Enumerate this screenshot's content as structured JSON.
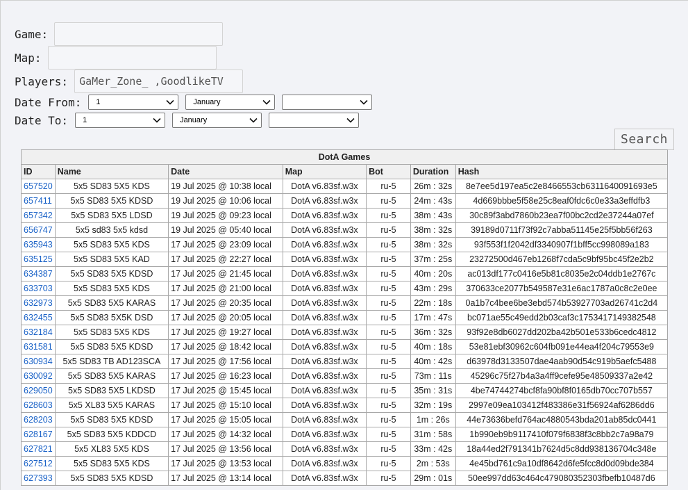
{
  "form": {
    "game_label": "Game:",
    "game_value": "",
    "map_label": "Map:",
    "map_value": "",
    "players_label": "Players:",
    "players_value": "GaMer_Zone_ ,GoodlikeTV",
    "date_from_label": "Date From:",
    "date_from_day": "1",
    "date_from_month": "January",
    "date_from_year": "",
    "date_to_label": "Date To:",
    "date_to_day": "1",
    "date_to_month": "January",
    "date_to_year": "",
    "search_label": "Search"
  },
  "table": {
    "title": "DotA Games",
    "headers": [
      "ID",
      "Name",
      "Date",
      "Map",
      "Bot",
      "Duration",
      "Hash"
    ],
    "rows": [
      [
        "657520",
        "5x5 SD83 5X5 KDS",
        "19 Jul 2025 @ 10:38 local",
        "DotA v6.83sf.w3x",
        "ru-5",
        "26m : 32s",
        "8e7ee5d197ea5c2e8466553cb6311640091693e5"
      ],
      [
        "657411",
        "5x5 SD83 5X5 KDSD",
        "19 Jul 2025 @ 10:06 local",
        "DotA v6.83sf.w3x",
        "ru-5",
        "24m : 43s",
        "4d669bbbe5f58e25c8eaf0fdc6c0e33a3effdfb3"
      ],
      [
        "657342",
        "5x5 SD83 5X5 LDSD",
        "19 Jul 2025 @ 09:23 local",
        "DotA v6.83sf.w3x",
        "ru-5",
        "38m : 43s",
        "30c89f3abd7860b23ea7f00bc2cd2e37244a07ef"
      ],
      [
        "656747",
        "5x5 sd83 5x5 kdsd",
        "19 Jul 2025 @ 05:40 local",
        "DotA v6.83sf.w3x",
        "ru-5",
        "38m : 32s",
        "39189d0711f73f92c7abba51145e25f5bb56f263"
      ],
      [
        "635943",
        "5x5 SD83 5X5 KDS",
        "17 Jul 2025 @ 23:09 local",
        "DotA v6.83sf.w3x",
        "ru-5",
        "38m : 32s",
        "93f553f1f2042df3340907f1bff5cc998089a183"
      ],
      [
        "635125",
        "5x5 SD83 5X5 KAD",
        "17 Jul 2025 @ 22:27 local",
        "DotA v6.83sf.w3x",
        "ru-5",
        "37m : 25s",
        "23272500d467eb1268f7cda5c9bf95bc45f2e2b2"
      ],
      [
        "634387",
        "5x5 SD83 5X5 KDSD",
        "17 Jul 2025 @ 21:45 local",
        "DotA v6.83sf.w3x",
        "ru-5",
        "40m : 20s",
        "ac013df177c0416e5b81c8035e2c04ddb1e2767c"
      ],
      [
        "633703",
        "5x5 SD83 5X5 KDS",
        "17 Jul 2025 @ 21:00 local",
        "DotA v6.83sf.w3x",
        "ru-5",
        "43m : 29s",
        "370633ce2077b549587e31e6ac1787a0c8c2e0ee"
      ],
      [
        "632973",
        "5x5 SD83 5X5 KARAS",
        "17 Jul 2025 @ 20:35 local",
        "DotA v6.83sf.w3x",
        "ru-5",
        "22m : 18s",
        "0a1b7c4bee6be3ebd574b53927703ad26741c2d4"
      ],
      [
        "632455",
        "5x5 SD83 5X5K DSD",
        "17 Jul 2025 @ 20:05 local",
        "DotA v6.83sf.w3x",
        "ru-5",
        "17m : 47s",
        "bc071ae55c49edd2b03caf3c1753417149382548"
      ],
      [
        "632184",
        "5x5 SD83 5X5 KDS",
        "17 Jul 2025 @ 19:27 local",
        "DotA v6.83sf.w3x",
        "ru-5",
        "36m : 32s",
        "93f92e8db6027dd202ba42b501e533b6cedc4812"
      ],
      [
        "631581",
        "5x5 SD83 5X5 KDSD",
        "17 Jul 2025 @ 18:42 local",
        "DotA v6.83sf.w3x",
        "ru-5",
        "40m : 18s",
        "53e81ebf30962c604fb091e44ea4f204c79553e9"
      ],
      [
        "630934",
        "5x5 SD83 TB AD123SCA",
        "17 Jul 2025 @ 17:56 local",
        "DotA v6.83sf.w3x",
        "ru-5",
        "40m : 42s",
        "d63978d3133507dae4aab90d54c919b5aefc5488"
      ],
      [
        "630092",
        "5x5 SD83 5X5 KARAS",
        "17 Jul 2025 @ 16:23 local",
        "DotA v6.83sf.w3x",
        "ru-5",
        "73m : 11s",
        "45296c75f27b4a3a4ff9cefe95e48509337a2e42"
      ],
      [
        "629050",
        "5x5 SD83 5X5 LKDSD",
        "17 Jul 2025 @ 15:45 local",
        "DotA v6.83sf.w3x",
        "ru-5",
        "35m : 31s",
        "4be74744274bcf8fa90bf8f0165db70cc707b557"
      ],
      [
        "628603",
        "5x5 XL83 5X5 KARAS",
        "17 Jul 2025 @ 15:10 local",
        "DotA v6.83sf.w3x",
        "ru-5",
        "32m : 19s",
        "2997e09ea103412f483386e31f56924af6286dd6"
      ],
      [
        "628203",
        "5x5 SD83 5X5 KDSD",
        "17 Jul 2025 @ 15:05 local",
        "DotA v6.83sf.w3x",
        "ru-5",
        "1m : 26s",
        "44e73636befd764ac4880543bda201ab85dc0441"
      ],
      [
        "628167",
        "5x5 SD83 5X5 KDDCD",
        "17 Jul 2025 @ 14:32 local",
        "DotA v6.83sf.w3x",
        "ru-5",
        "31m : 58s",
        "1b990eb9b9117410f079f6838f3c8bb2c7a98a79"
      ],
      [
        "627821",
        "5x5 XL83 5X5 KDS",
        "17 Jul 2025 @ 13:56 local",
        "DotA v6.83sf.w3x",
        "ru-5",
        "33m : 42s",
        "18a44ed2f791341b7624d5c8dd938136704c348e"
      ],
      [
        "627512",
        "5x5 SD83 5X5 KDS",
        "17 Jul 2025 @ 13:53 local",
        "DotA v6.83sf.w3x",
        "ru-5",
        "2m : 53s",
        "4e45bd761c9a10df8642d6fe5fcc8d0d09bde384"
      ],
      [
        "627393",
        "5x5 SD83 5X5 KDSD",
        "17 Jul 2025 @ 13:14 local",
        "DotA v6.83sf.w3x",
        "ru-5",
        "29m : 01s",
        "50ee997dd63c464c479080352303fbefb10487d6"
      ]
    ]
  }
}
